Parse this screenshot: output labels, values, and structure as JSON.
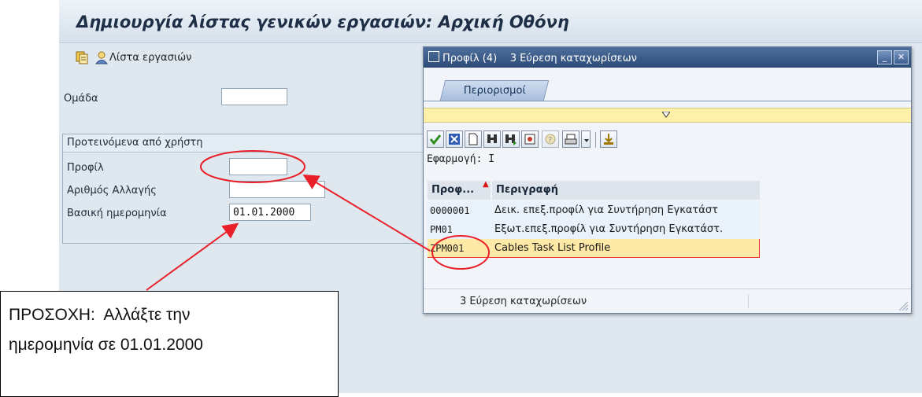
{
  "window": {
    "title": "Δημιουργία λίστας γενικών εργασιών: Αρχική Οθόνη"
  },
  "toolbar": {
    "task_list_label": "Λίστα εργασιών",
    "icons": [
      "copy-icon",
      "user-icon"
    ]
  },
  "form": {
    "group_label": "Ομάδα",
    "group_value": "",
    "defaults_section_title": "Προτεινόμενα από χρήστη",
    "profile_label": "Προφίλ",
    "profile_value": "",
    "change_number_label": "Αριθμός Αλλαγής",
    "change_number_value": "",
    "key_date_label": "Βασική ημερομηνία",
    "key_date_value": "01.01.2000"
  },
  "popup": {
    "title": "Προφίλ (4)    3 Εύρεση καταχωρίσεων",
    "tab_restrictions": "Περιορισμοί",
    "application_label": "Εφαρμογή: I",
    "columns": [
      "Προφ...",
      "Περιγραφή"
    ],
    "rows": [
      {
        "code": "0000001",
        "description": "Δεικ. επεξ.προφίλ για Συντήρηση Εγκατάστ"
      },
      {
        "code": "PM01",
        "description": "Εξωτ.επεξ.προφίλ για Συντήρηση Εγκατάστ."
      },
      {
        "code": "ZPM001",
        "description": "Cables Task List Profile",
        "selected": true
      }
    ],
    "status": "3 Εύρεση καταχωρίσεων",
    "toolbar_icons": [
      "checkmark-icon",
      "cancel-icon",
      "new-icon",
      "find-icon",
      "find-next-icon",
      "settings-icon",
      "help-icon",
      "print-icon",
      "dropdown-icon",
      "sort-icon"
    ]
  },
  "annotation": {
    "line1": "ΠΡΟΣΟΧΗ:  Αλλάξτε την",
    "line2": "ημερομηνία σε 01.01.2000",
    "color": "#e8202a"
  },
  "colors": {
    "selected_row": "#ffe9a6",
    "row_alt": "#e9f2fb",
    "title_blue": "#2c4b77"
  }
}
